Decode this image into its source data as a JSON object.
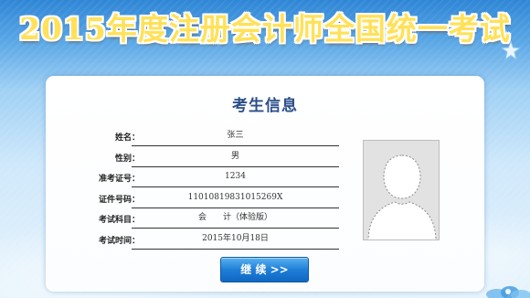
{
  "banner": {
    "title": "2015年度注册会计师全国统一考试"
  },
  "card": {
    "title": "考生信息",
    "fields": [
      {
        "label": "姓名",
        "value": "张三"
      },
      {
        "label": "性别",
        "value": "男"
      },
      {
        "label": "准考证号",
        "value": "1234"
      },
      {
        "label": "证件号码",
        "value": "11010819831015269X"
      },
      {
        "label": "考试科目",
        "value": "会　　计（体验版）"
      },
      {
        "label": "考试时间",
        "value": "2015年10月18日"
      }
    ],
    "colon": "：",
    "photo_icon": "user-silhouette-icon"
  },
  "buttons": {
    "continue_label": "继 续 >>"
  },
  "colors": {
    "title_gold": "#ffb21e",
    "card_title_blue": "#2b4e8a",
    "button_blue": "#1f7fd8"
  }
}
